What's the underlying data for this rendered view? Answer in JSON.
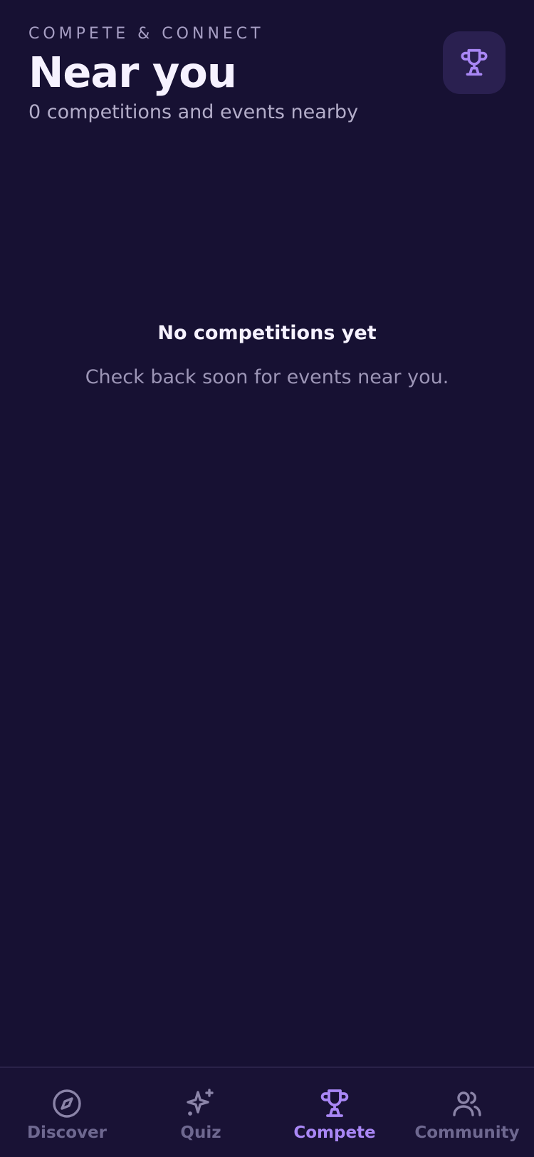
{
  "header": {
    "eyebrow": "COMPETE & CONNECT",
    "title": "Near you",
    "subtitle": "0 competitions and events nearby",
    "action_icon": "trophy-icon"
  },
  "empty_state": {
    "title": "No competitions yet",
    "message": "Check back soon for events near you."
  },
  "bottom_nav": {
    "items": [
      {
        "label": "Discover",
        "icon": "compass-icon",
        "active": false
      },
      {
        "label": "Quiz",
        "icon": "sparkle-icon",
        "active": false
      },
      {
        "label": "Compete",
        "icon": "trophy-icon",
        "active": true
      },
      {
        "label": "Community",
        "icon": "users-icon",
        "active": false
      }
    ]
  },
  "colors": {
    "background": "#171133",
    "accent": "#a987f5",
    "muted": "#6e6890",
    "text": "#f6f2ff"
  }
}
